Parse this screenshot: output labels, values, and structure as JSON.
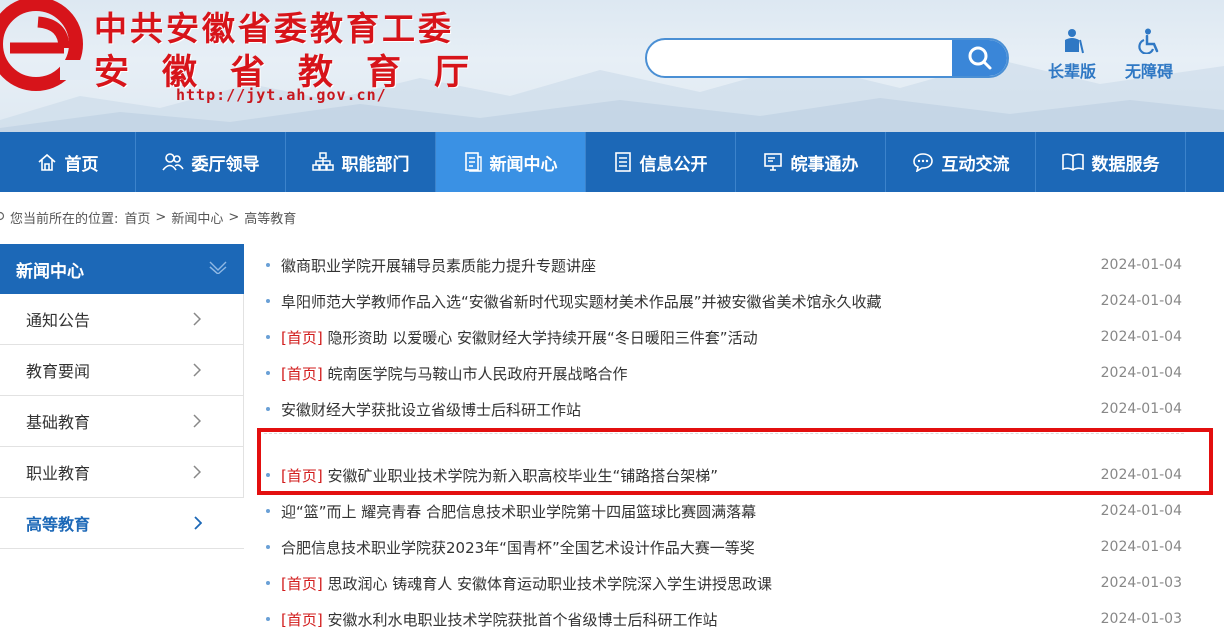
{
  "header": {
    "logo_letter": "e",
    "title_line1": "中共安徽省委教育工委",
    "title_line2": "安徽省教育厅",
    "url": "http://jyt.ah.gov.cn/",
    "search_placeholder": "",
    "tools": [
      {
        "label": "长辈版",
        "icon": "elder-icon"
      },
      {
        "label": "无障碍",
        "icon": "accessibility-icon"
      }
    ],
    "colors": {
      "brand_red": "#d7141a",
      "nav_blue": "#1c68b7",
      "nav_active": "#3a91e4"
    }
  },
  "nav": {
    "items": [
      {
        "label": "首页",
        "icon": "home-icon"
      },
      {
        "label": "委厅领导",
        "icon": "people-icon"
      },
      {
        "label": "职能部门",
        "icon": "org-chart-icon"
      },
      {
        "label": "新闻中心",
        "icon": "document-icon",
        "active": true
      },
      {
        "label": "信息公开",
        "icon": "list-doc-icon"
      },
      {
        "label": "皖事通办",
        "icon": "monitor-icon"
      },
      {
        "label": "互动交流",
        "icon": "chat-icon"
      },
      {
        "label": "数据服务",
        "icon": "book-icon"
      }
    ]
  },
  "breadcrumb": {
    "prefix": "您当前所在的位置:",
    "items": [
      "首页",
      "新闻中心",
      "高等教育"
    ],
    "separator": ">"
  },
  "sidebar": {
    "title": "新闻中心",
    "items": [
      {
        "label": "通知公告"
      },
      {
        "label": "教育要闻"
      },
      {
        "label": "基础教育"
      },
      {
        "label": "职业教育"
      },
      {
        "label": "高等教育",
        "active": true
      }
    ]
  },
  "news": [
    {
      "tag": "",
      "title": "徽商职业学院开展辅导员素质能力提升专题讲座",
      "date": "2024-01-04"
    },
    {
      "tag": "",
      "title": "阜阳师范大学教师作品入选“安徽省新时代现实题材美术作品展”并被安徽省美术馆永久收藏",
      "date": "2024-01-04"
    },
    {
      "tag": "[首页]",
      "title": " 隐形资助 以爱暖心 安徽财经大学持续开展“冬日暖阳三件套”活动",
      "date": "2024-01-04"
    },
    {
      "tag": "[首页]",
      "title": " 皖南医学院与马鞍山市人民政府开展战略合作",
      "date": "2024-01-04"
    },
    {
      "tag": "",
      "title": "安徽财经大学获批设立省级博士后科研工作站",
      "date": "2024-01-04"
    },
    {
      "tag": "[首页]",
      "title": " 安徽矿业职业技术学院为新入职高校毕业生“铺路搭台架梯”",
      "date": "2024-01-04"
    },
    {
      "tag": "",
      "title": "迎“篮”而上 耀亮青春 合肥信息技术职业学院第十四届篮球比赛圆满落幕",
      "date": "2024-01-04"
    },
    {
      "tag": "",
      "title": "合肥信息技术职业学院获2023年“国青杯”全国艺术设计作品大赛一等奖",
      "date": "2024-01-04"
    },
    {
      "tag": "[首页]",
      "title": " 思政润心 铸魂育人 安徽体育运动职业技术学院深入学生讲授思政课",
      "date": "2024-01-03"
    },
    {
      "tag": "[首页]",
      "title": " 安徽水利水电职业技术学院获批首个省级博士后科研工作站",
      "date": "2024-01-03"
    }
  ]
}
